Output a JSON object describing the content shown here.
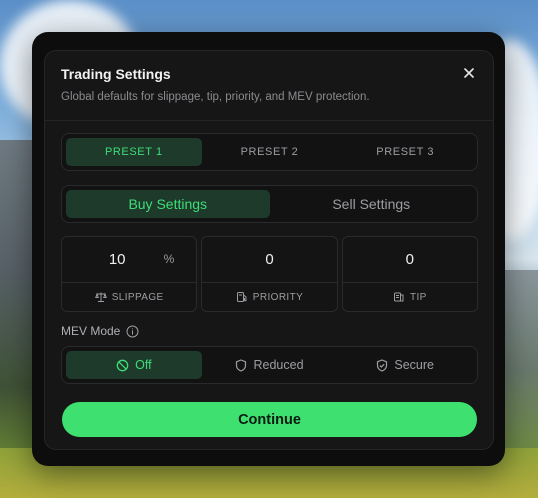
{
  "dialog": {
    "title": "Trading Settings",
    "subtitle": "Global defaults for slippage, tip, priority, and MEV protection.",
    "close_icon": "close-icon"
  },
  "presets": {
    "items": [
      {
        "label": "PRESET 1",
        "active": true
      },
      {
        "label": "PRESET 2",
        "active": false
      },
      {
        "label": "PRESET 3",
        "active": false
      }
    ]
  },
  "sides": {
    "items": [
      {
        "label": "Buy Settings",
        "active": true
      },
      {
        "label": "Sell Settings",
        "active": false
      }
    ]
  },
  "fields": {
    "slippage": {
      "value": "10",
      "unit": "%",
      "label": "SLIPPAGE",
      "icon": "scale-icon"
    },
    "priority": {
      "value": "0",
      "label": "PRIORITY",
      "icon": "fuel-icon"
    },
    "tip": {
      "value": "0",
      "label": "TIP",
      "icon": "coins-icon"
    }
  },
  "mev": {
    "label": "MEV Mode",
    "info_icon": "info-icon",
    "options": [
      {
        "label": "Off",
        "icon": "ban-icon",
        "active": true
      },
      {
        "label": "Reduced",
        "icon": "shield-icon",
        "active": false
      },
      {
        "label": "Secure",
        "icon": "shield-check-icon",
        "active": false
      }
    ]
  },
  "continue_label": "Continue",
  "colors": {
    "accent": "#3ee06f",
    "active_bg": "#1d3a2a",
    "panel": "#161617"
  }
}
